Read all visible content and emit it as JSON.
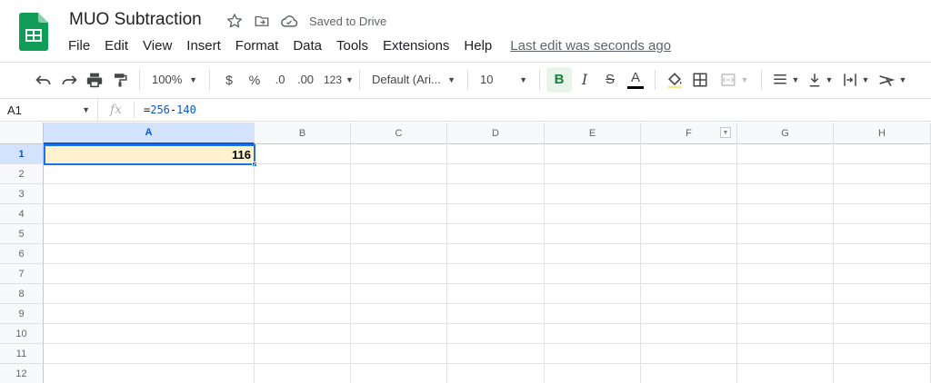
{
  "app": {
    "title": "MUO Subtraction",
    "saved_status": "Saved to Drive",
    "menu": [
      "File",
      "Edit",
      "View",
      "Insert",
      "Format",
      "Data",
      "Tools",
      "Extensions",
      "Help"
    ],
    "last_edit": "Last edit was seconds ago"
  },
  "toolbar": {
    "zoom": "100%",
    "currency": "$",
    "percent": "%",
    "decrease_decimals": ".0",
    "increase_decimals": ".00",
    "more_formats": "123",
    "font": "Default (Ari...",
    "font_size": "10",
    "bold": "B",
    "italic": "I",
    "strikethrough": "S",
    "text_color": "A"
  },
  "formula_bar": {
    "name_box": "A1",
    "fx": "fx",
    "formula_prefix": "=",
    "operand1": "256",
    "operator": "-",
    "operand2": "140"
  },
  "grid": {
    "columns": [
      "A",
      "B",
      "C",
      "D",
      "E",
      "F",
      "G",
      "H"
    ],
    "rows": [
      "1",
      "2",
      "3",
      "4",
      "5",
      "6",
      "7",
      "8",
      "9",
      "10",
      "11",
      "12"
    ],
    "active_cell": {
      "ref": "A1",
      "value": "116"
    }
  },
  "colors": {
    "sheets_green": "#0f9d58",
    "active_cell_fill": "#fff2cc",
    "selection_blue": "#1a73e8"
  }
}
